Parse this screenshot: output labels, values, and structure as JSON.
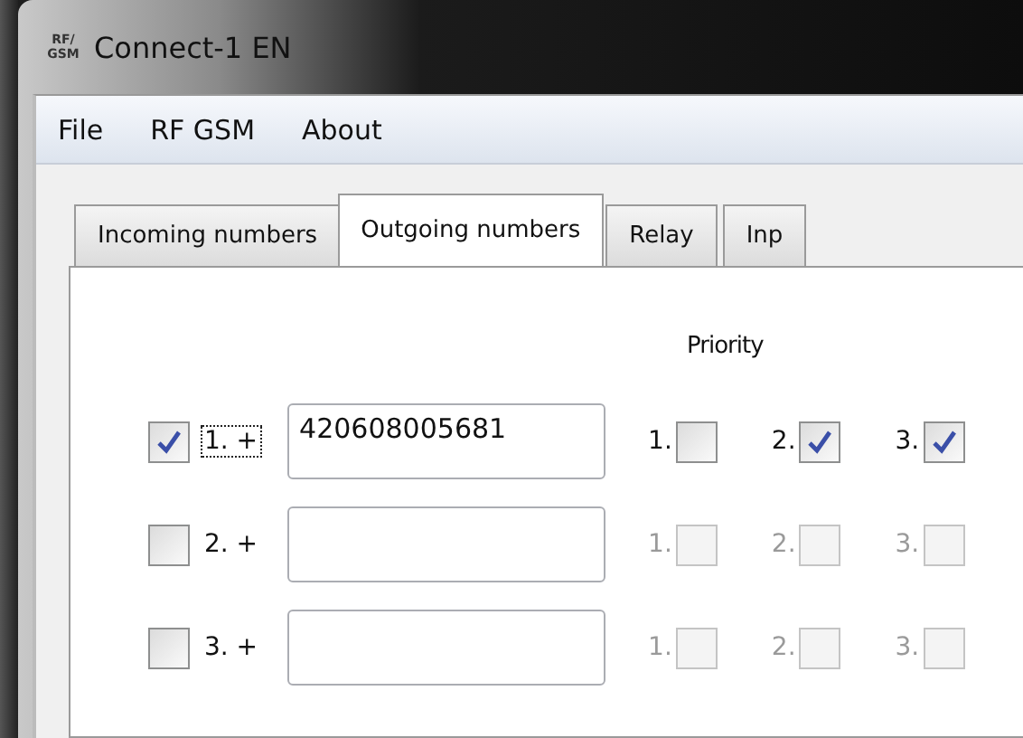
{
  "window": {
    "title": "Connect-1 EN",
    "icon_text": "RF/ GSM"
  },
  "menu": [
    "File",
    "RF GSM",
    "About"
  ],
  "tabs": [
    {
      "label": "Incoming numbers",
      "selected": false
    },
    {
      "label": "Outgoing numbers",
      "selected": true
    },
    {
      "label": "Relay",
      "selected": false
    },
    {
      "label": "Inp",
      "selected": false
    }
  ],
  "priority_heading": "Priority",
  "numbers": [
    {
      "label": "1. +",
      "checked": true,
      "focused": true,
      "value": "420608005681",
      "priorities": [
        {
          "label": "1.",
          "checked": false,
          "disabled": false
        },
        {
          "label": "2.",
          "checked": true,
          "disabled": false
        },
        {
          "label": "3.",
          "checked": true,
          "disabled": false
        }
      ]
    },
    {
      "label": "2. +",
      "checked": false,
      "focused": false,
      "priorities": [
        {
          "label": "1.",
          "checked": false,
          "disabled": true
        },
        {
          "label": "2.",
          "checked": false,
          "disabled": true
        },
        {
          "label": "3.",
          "checked": false,
          "disabled": true
        }
      ]
    },
    {
      "label": "3. +",
      "checked": false,
      "focused": false,
      "priorities": [
        {
          "label": "1.",
          "checked": false,
          "disabled": true
        },
        {
          "label": "2.",
          "checked": false,
          "disabled": true
        },
        {
          "label": "3.",
          "checked": false,
          "disabled": true
        }
      ]
    }
  ]
}
